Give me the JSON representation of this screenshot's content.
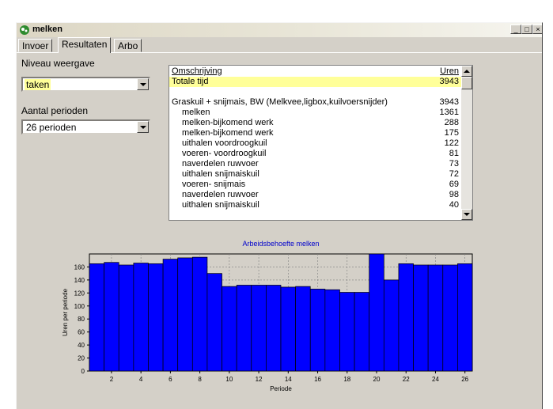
{
  "window": {
    "title": "melken",
    "controls": {
      "minimize": "_",
      "maximize": "□",
      "close": "×"
    }
  },
  "tabs": [
    {
      "label": "Invoer",
      "active": false
    },
    {
      "label": "Resultaten",
      "active": true
    },
    {
      "label": "Arbo",
      "active": false
    }
  ],
  "niveau": {
    "label": "Niveau weergave",
    "value": "taken"
  },
  "perioden": {
    "label": "Aantal perioden",
    "value": "26 perioden"
  },
  "grid": {
    "columns": {
      "description": "Omschrijving",
      "hours": "Uren"
    },
    "total": {
      "description": "Totale tijd",
      "hours": "3943"
    },
    "rows": [
      {
        "description": "Graskuil + snijmais, BW (Melkvee,ligbox,kuilvoersnijder)",
        "hours": "3943",
        "indent": false
      },
      {
        "description": "melken",
        "hours": "1361",
        "indent": true
      },
      {
        "description": "melken-bijkomend werk",
        "hours": "288",
        "indent": true
      },
      {
        "description": "melken-bijkomend werk",
        "hours": "175",
        "indent": true
      },
      {
        "description": "uithalen voordroogkuil",
        "hours": "122",
        "indent": true
      },
      {
        "description": "voeren- voordroogkuil",
        "hours": "81",
        "indent": true
      },
      {
        "description": "naverdelen ruwvoer",
        "hours": "73",
        "indent": true
      },
      {
        "description": "uithalen snijmaiskuil",
        "hours": "72",
        "indent": true
      },
      {
        "description": "voeren- snijmais",
        "hours": "69",
        "indent": true
      },
      {
        "description": "naverdelen ruwvoer",
        "hours": "98",
        "indent": true
      },
      {
        "description": "uithalen snijmaiskuil",
        "hours": "40",
        "indent": true
      }
    ]
  },
  "colors": {
    "window_bg": "#d4d0c8",
    "highlight": "#ffff99",
    "bar": "#0000ff",
    "title_blue": "#0000cc"
  },
  "chart_data": {
    "type": "bar",
    "title": "Arbeidsbehoefte melken",
    "xlabel": "Periode",
    "ylabel": "Uren per periode",
    "categories": [
      1,
      2,
      3,
      4,
      5,
      6,
      7,
      8,
      9,
      10,
      11,
      12,
      13,
      14,
      15,
      16,
      17,
      18,
      19,
      20,
      21,
      22,
      23,
      24,
      25,
      26
    ],
    "values": [
      165,
      167,
      163,
      166,
      165,
      172,
      174,
      175,
      150,
      130,
      132,
      132,
      132,
      129,
      130,
      126,
      125,
      121,
      121,
      180,
      140,
      165,
      163,
      163,
      163,
      165
    ],
    "xticks": [
      2,
      4,
      6,
      8,
      10,
      12,
      14,
      16,
      18,
      20,
      22,
      24,
      26
    ],
    "yticks": [
      0,
      20,
      40,
      60,
      80,
      100,
      120,
      140,
      160
    ],
    "ylim": [
      0,
      180
    ],
    "grid": true
  }
}
